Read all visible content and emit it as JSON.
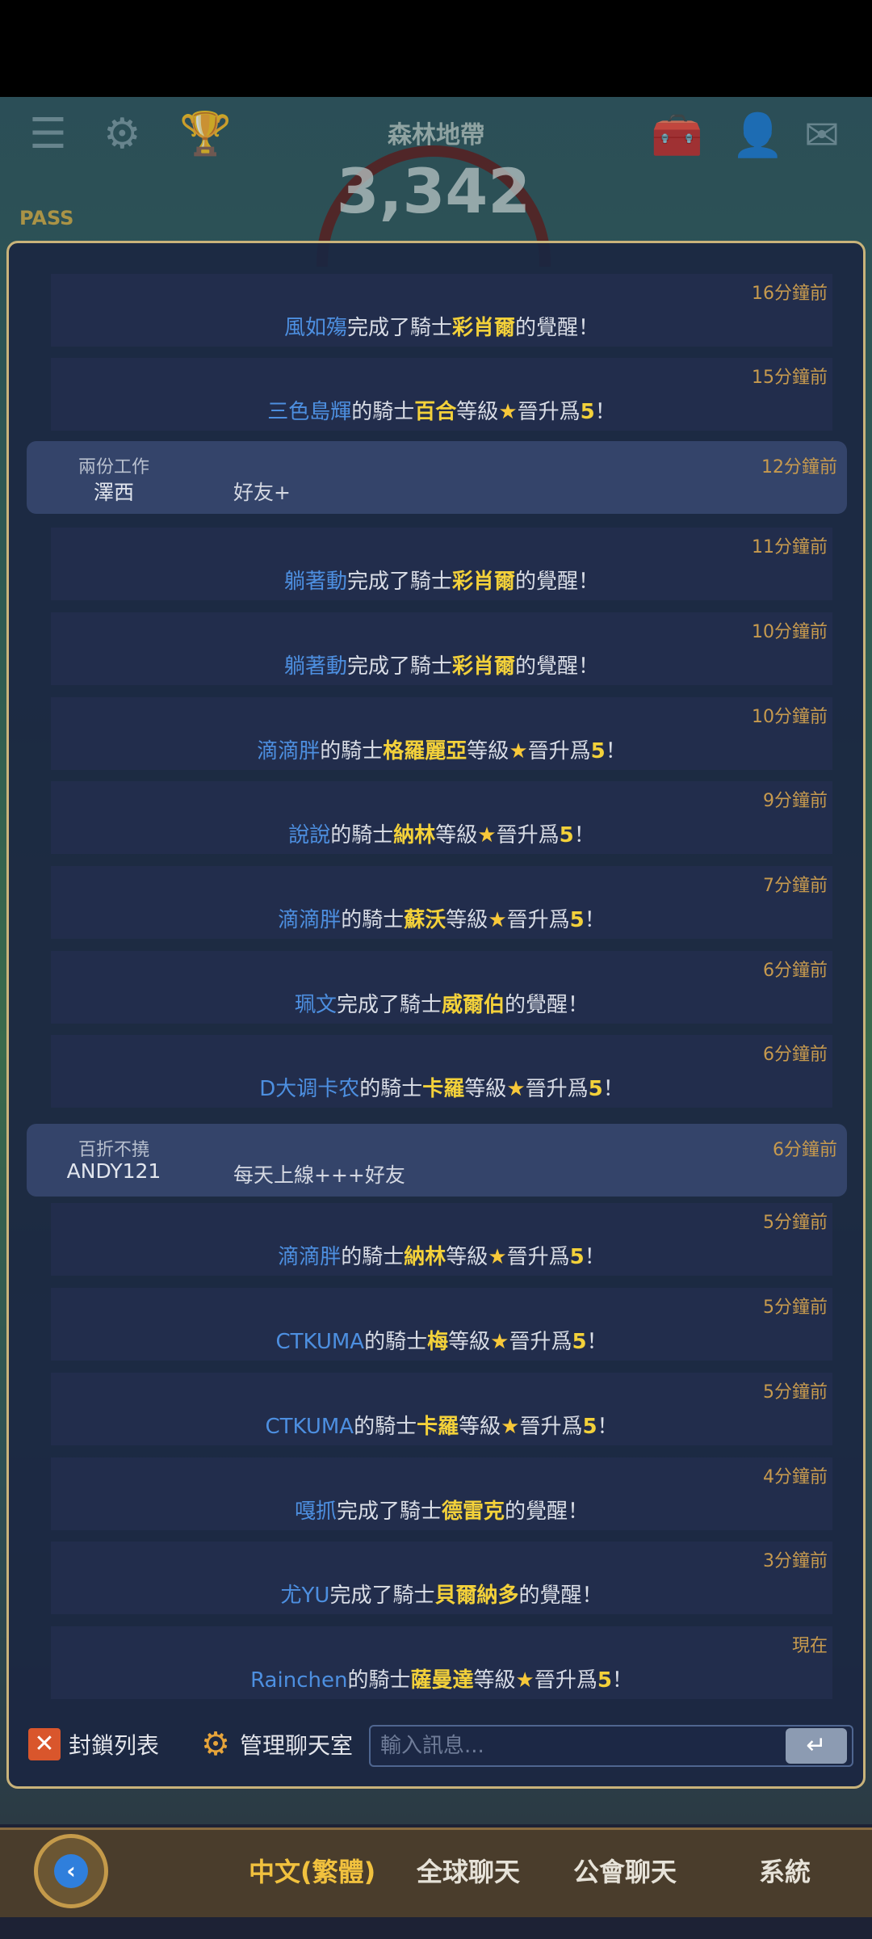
{
  "hud": {
    "area_title": "森林地帶",
    "score": "3,342",
    "pass_label": "PASS"
  },
  "system_messages": [
    {
      "user": "風如殤",
      "action": "awaken",
      "pre": "完成了騎士",
      "knight": "彩肖爾",
      "post": "的覺醒！",
      "time": "16分鐘前"
    },
    {
      "user": "三色島輝",
      "action": "level",
      "pre": "的騎士",
      "knight": "百合",
      "mid": "等級",
      "star": "★",
      "post": "晉升爲",
      "level": "5",
      "end": "！",
      "time": "15分鐘前"
    },
    {
      "user": "躺著動",
      "action": "awaken",
      "pre": "完成了騎士",
      "knight": "彩肖爾",
      "post": "的覺醒！",
      "time": "11分鐘前"
    },
    {
      "user": "躺著動",
      "action": "awaken",
      "pre": "完成了騎士",
      "knight": "彩肖爾",
      "post": "的覺醒！",
      "time": "10分鐘前"
    },
    {
      "user": "滴滴胖",
      "action": "level",
      "pre": "的騎士",
      "knight": "格羅麗亞",
      "mid": "等級",
      "star": "★",
      "post": "晉升爲",
      "level": "5",
      "end": "！",
      "time": "10分鐘前"
    },
    {
      "user": "說說",
      "action": "level",
      "pre": "的騎士",
      "knight": "納林",
      "mid": "等級",
      "star": "★",
      "post": "晉升爲",
      "level": "5",
      "end": "！",
      "time": "9分鐘前"
    },
    {
      "user": "滴滴胖",
      "action": "level",
      "pre": "的騎士",
      "knight": "蘇沃",
      "mid": "等級",
      "star": "★",
      "post": "晉升爲",
      "level": "5",
      "end": "！",
      "time": "7分鐘前"
    },
    {
      "user": "珮文",
      "action": "awaken",
      "pre": "完成了騎士",
      "knight": "威爾伯",
      "post": "的覺醒！",
      "time": "6分鐘前"
    },
    {
      "user": "D大调卡农",
      "action": "level",
      "pre": "的騎士",
      "knight": "卡羅",
      "mid": "等級",
      "star": "★",
      "post": "晉升爲",
      "level": "5",
      "end": "！",
      "time": "6分鐘前"
    },
    {
      "user": "滴滴胖",
      "action": "level",
      "pre": "的騎士",
      "knight": "納林",
      "mid": "等級",
      "star": "★",
      "post": "晉升爲",
      "level": "5",
      "end": "！",
      "time": "5分鐘前"
    },
    {
      "user": "CTKUMA",
      "action": "level",
      "pre": "的騎士",
      "knight": "梅",
      "mid": "等級",
      "star": "★",
      "post": "晉升爲",
      "level": "5",
      "end": "！",
      "time": "5分鐘前"
    },
    {
      "user": "CTKUMA",
      "action": "level",
      "pre": "的騎士",
      "knight": "卡羅",
      "mid": "等級",
      "star": "★",
      "post": "晉升爲",
      "level": "5",
      "end": "！",
      "time": "5分鐘前"
    },
    {
      "user": "嘎抓",
      "action": "awaken",
      "pre": "完成了騎士",
      "knight": "德雷克",
      "post": "的覺醒！",
      "time": "4分鐘前"
    },
    {
      "user": "尤YU",
      "action": "awaken",
      "pre": "完成了騎士",
      "knight": "貝爾納多",
      "post": "的覺醒！",
      "time": "3分鐘前"
    },
    {
      "user": "Rainchen",
      "action": "level",
      "pre": "的騎士",
      "knight": "薩曼達",
      "mid": "等級",
      "star": "★",
      "post": "晉升爲",
      "level": "5",
      "end": "！",
      "time": "現在"
    }
  ],
  "user_messages": [
    {
      "title": "兩份工作",
      "name": "澤西",
      "text": "好友+",
      "time": "12分鐘前"
    },
    {
      "title": "百折不撓",
      "name": "ANDY121",
      "text": "每天上線+++好友",
      "time": "6分鐘前"
    }
  ],
  "toolbar": {
    "block_list": "封鎖列表",
    "manage_room": "管理聊天室",
    "input_placeholder": "輸入訊息...",
    "send_icon": "↵"
  },
  "tabs": [
    {
      "label": "中文(繁體)",
      "active": true
    },
    {
      "label": "全球聊天",
      "active": false
    },
    {
      "label": "公會聊天",
      "active": false
    },
    {
      "label": "系統",
      "active": false
    }
  ],
  "colors": {
    "user_name": "#4d8fe0",
    "knight_name": "#f3d13a",
    "timestamp": "#c79a4e",
    "panel_border": "#c9b37a",
    "active_tab": "#f1c13e"
  }
}
